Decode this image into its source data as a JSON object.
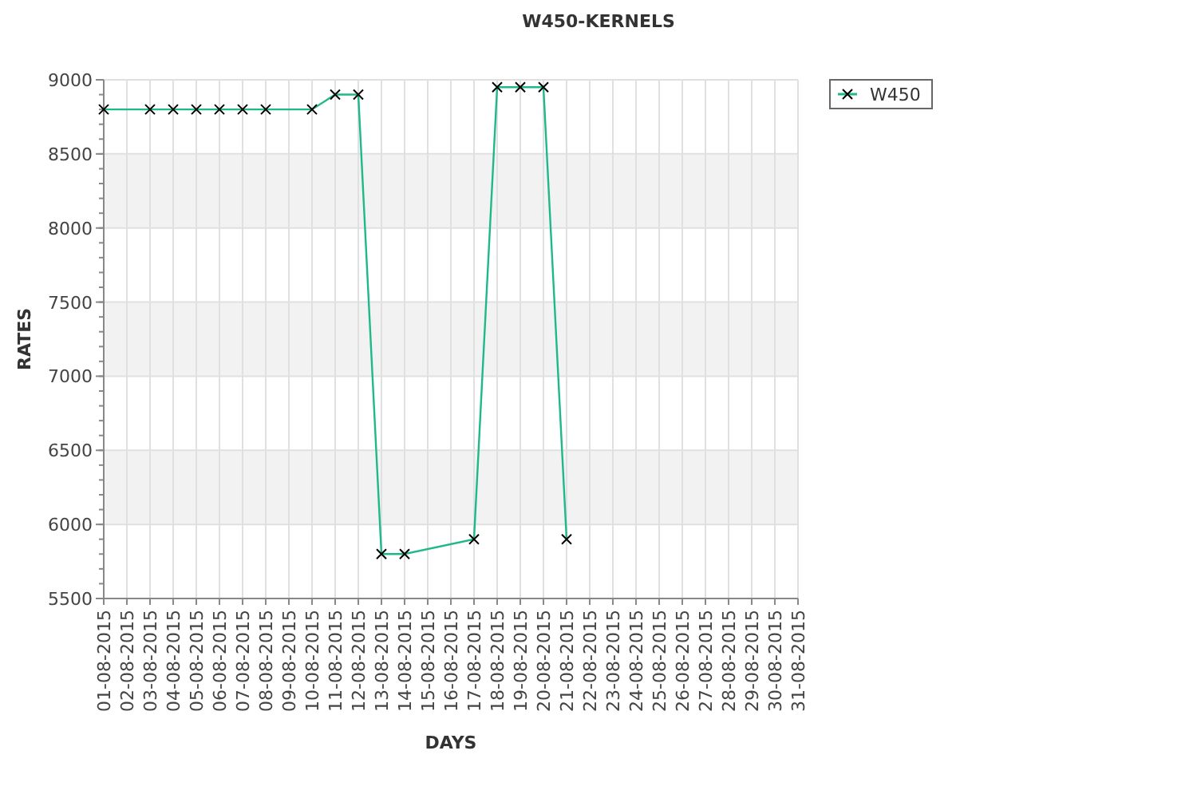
{
  "chart_data": {
    "type": "line",
    "title": "W450-KERNELS",
    "xlabel": "DAYS",
    "ylabel": "RATES",
    "categories": [
      "01-08-2015",
      "02-08-2015",
      "03-08-2015",
      "04-08-2015",
      "05-08-2015",
      "06-08-2015",
      "07-08-2015",
      "08-08-2015",
      "09-08-2015",
      "10-08-2015",
      "11-08-2015",
      "12-08-2015",
      "13-08-2015",
      "14-08-2015",
      "15-08-2015",
      "16-08-2015",
      "17-08-2015",
      "18-08-2015",
      "19-08-2015",
      "20-08-2015",
      "21-08-2015",
      "22-08-2015",
      "23-08-2015",
      "24-08-2015",
      "25-08-2015",
      "26-08-2015",
      "27-08-2015",
      "28-08-2015",
      "29-08-2015",
      "30-08-2015",
      "31-08-2015"
    ],
    "grid": true,
    "series": [
      {
        "name": "W450",
        "color": "#1fb88a",
        "marker": "x",
        "values": [
          8800,
          null,
          8800,
          8800,
          8800,
          8800,
          8800,
          8800,
          null,
          8800,
          8900,
          8900,
          5800,
          5800,
          null,
          null,
          5900,
          8950,
          8950,
          8950,
          5900,
          null,
          null,
          null,
          null,
          null,
          null,
          null,
          null,
          null,
          null
        ]
      }
    ],
    "ylim": [
      5500,
      9000
    ],
    "yticks": [
      5500,
      6000,
      6500,
      7000,
      7500,
      8000,
      8500,
      9000
    ]
  }
}
